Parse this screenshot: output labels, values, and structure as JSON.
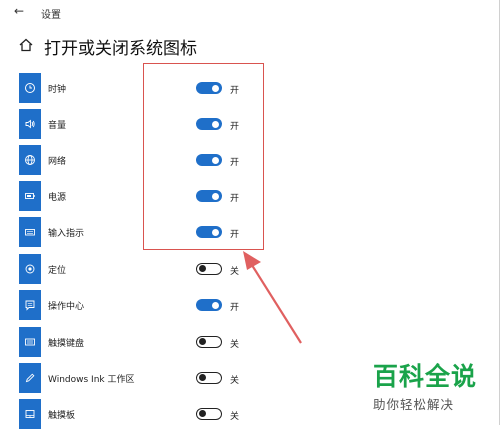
{
  "window": {
    "back_glyph": "←",
    "app_title": "设置"
  },
  "page": {
    "title": "打开或关闭系统图标"
  },
  "items": [
    {
      "label": "时钟",
      "on": true,
      "state": "开",
      "icon": "clock-icon"
    },
    {
      "label": "音量",
      "on": true,
      "state": "开",
      "icon": "volume-icon"
    },
    {
      "label": "网络",
      "on": true,
      "state": "开",
      "icon": "network-icon"
    },
    {
      "label": "电源",
      "on": true,
      "state": "开",
      "icon": "battery-icon"
    },
    {
      "label": "输入指示",
      "on": true,
      "state": "开",
      "icon": "keyboard-icon"
    },
    {
      "label": "定位",
      "on": false,
      "state": "关",
      "icon": "location-icon"
    },
    {
      "label": "操作中心",
      "on": true,
      "state": "开",
      "icon": "action-center-icon"
    },
    {
      "label": "触摸键盘",
      "on": false,
      "state": "关",
      "icon": "touch-keyboard-icon"
    },
    {
      "label": "Windows Ink 工作区",
      "on": false,
      "state": "关",
      "icon": "pen-icon"
    },
    {
      "label": "触摸板",
      "on": false,
      "state": "关",
      "icon": "touchpad-icon"
    }
  ],
  "watermark": {
    "name": "百科全说",
    "slogan": "助你轻松解决"
  },
  "colors": {
    "accent": "#1f6fc9",
    "highlight": "#d9534f",
    "brand": "#1aa34a"
  }
}
